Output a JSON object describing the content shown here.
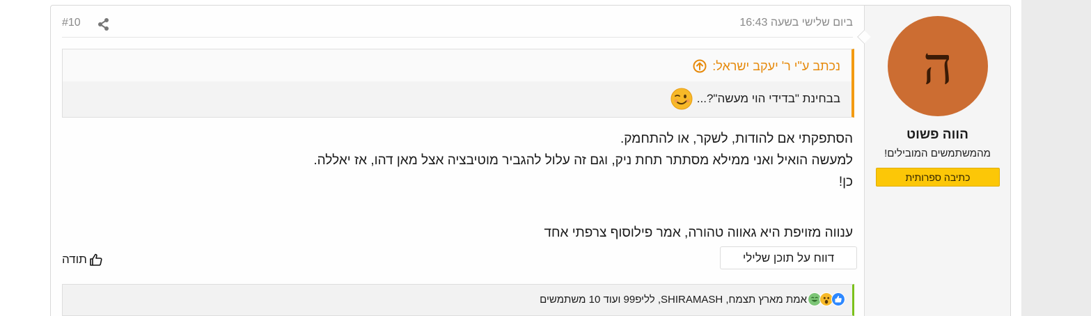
{
  "user": {
    "avatar_letter": "ה",
    "name": "הווה פשוט",
    "title": "מהמשתמשים המובילים!",
    "banner": "כתיבה ספרותית"
  },
  "post": {
    "date": "ביום שלישי בשעה 16:43",
    "number": "#10",
    "quote": {
      "author": "נכתב ע\"י ר' יעקב ישראל:",
      "text": "בבחינת \"בדידי הוי מעשה\"?..."
    },
    "body": [
      "הסתפקתי אם להודות, לשקר, או להתחמק.",
      "למעשה הואיל ואני ממילא מסתתר תחת ניק, וגם זה עלול להגביר מוטיבציה אצל מאן דהו, אז יאללה.",
      "כן!"
    ],
    "signature": "ענווה מזויפת היא גאווה טהורה, אמר פילוסוף צרפתי אחד"
  },
  "actions": {
    "report_label": "דווח על תוכן שלילי",
    "thanks_label": "תודה"
  },
  "reactions": {
    "text": "אמת מארץ תצמח, SHIRAMASH, לליפ99 ועוד 10 משתמשים"
  },
  "colors": {
    "avatar_bg": "#cc6d32",
    "quote_accent": "#f39b12",
    "banner_bg": "#fcc707",
    "reactions_accent": "#7cc11c"
  }
}
